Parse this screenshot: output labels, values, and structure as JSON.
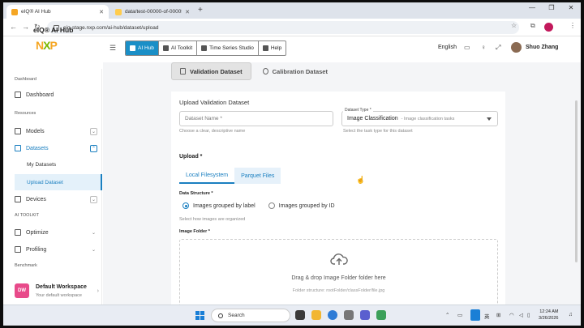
{
  "browser": {
    "tabs": [
      {
        "title": "eIQ® AI Hub",
        "active": true
      },
      {
        "title": "data/test-00000-of-00005.parq",
        "active": false
      }
    ],
    "url": "eiq-stage.nxp.com/ai-hub/dataset/upload"
  },
  "brand": {
    "logo": "NXP",
    "app_name": "eIQ® AI Hub"
  },
  "topnav": {
    "items": [
      "AI Hub",
      "AI Toolkit",
      "Time Series Studio",
      "Help"
    ],
    "active": "AI Hub"
  },
  "header": {
    "language": "English",
    "user": "Shuo Zhang"
  },
  "sidebar": {
    "sections": [
      "Dashboard",
      "Resources",
      "AI TOOLKIT",
      "Benchmark"
    ],
    "items": {
      "dashboard": "Dashboard",
      "models": "Models",
      "datasets": "Datasets",
      "my_datasets": "My Datasets",
      "upload_dataset": "Upload Dataset",
      "devices": "Devices",
      "optimize": "Optimize",
      "profiling": "Profiling"
    },
    "workspace": {
      "badge": "DW",
      "name": "Default Workspace",
      "subtitle": "Your default workspace"
    }
  },
  "main": {
    "tabs": [
      "Validation Dataset",
      "Calibration Dataset"
    ],
    "active_tab": "Validation Dataset",
    "form": {
      "title": "Upload Validation Dataset",
      "name_placeholder": "Dataset Name *",
      "name_hint": "Choose a clear, descriptive name",
      "type_label": "Dataset Type *",
      "type_value": "Image Classification",
      "type_desc": "- Image classification tasks",
      "type_hint": "Select the task type for this dataset",
      "upload_label": "Upload *",
      "upload_tabs": [
        "Local Filesystem",
        "Parquet Files"
      ],
      "active_upload_tab": "Local Filesystem",
      "structure_label": "Data Structure *",
      "structure_options": [
        "Images grouped by label",
        "Images grouped by ID"
      ],
      "structure_selected": "Images grouped by label",
      "structure_hint": "Select how images are organized",
      "folder_label": "Image Folder *",
      "drop_text": "Drag & drop Image Folder folder here",
      "drop_hint": "Folder structure: rootFolder/classFolder/file.jpg"
    }
  },
  "taskbar": {
    "search_placeholder": "Search",
    "ime": "英",
    "time": "12:24 AM",
    "date": "3/26/2026"
  },
  "colors": {
    "accent": "#1a8fc7",
    "link": "#1a7fc0",
    "workspace_badge": "#e84a8a"
  }
}
